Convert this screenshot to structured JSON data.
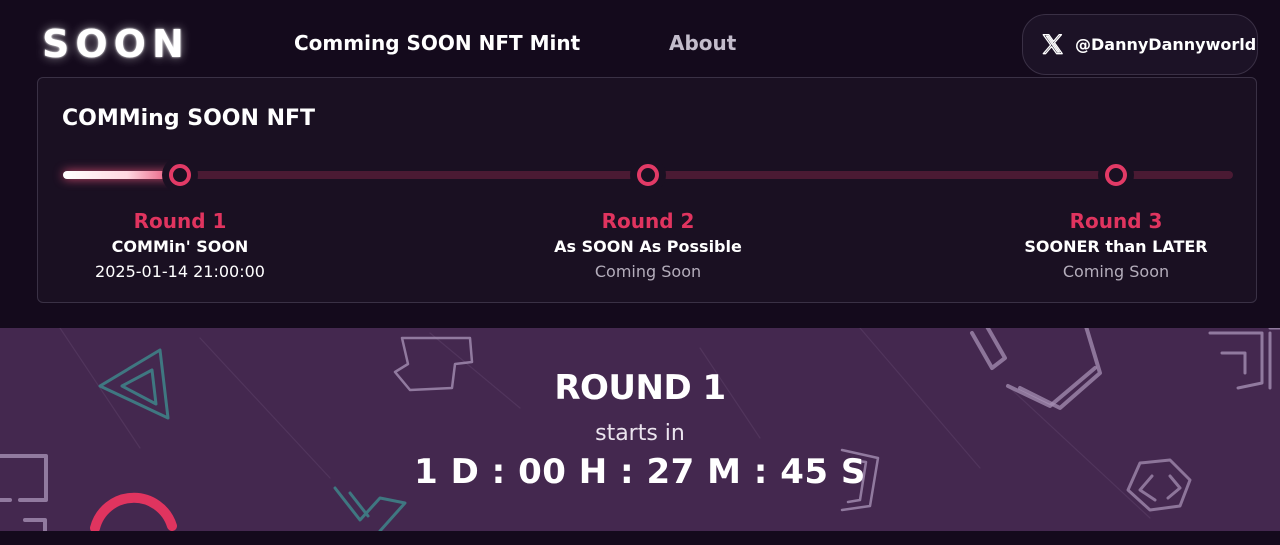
{
  "header": {
    "logo": "SOON",
    "nav": [
      {
        "label": "Comming SOON NFT Mint",
        "active": true
      },
      {
        "label": "About",
        "active": false
      }
    ],
    "social": {
      "icon": "x-logo-icon",
      "handle": "@DannyDannyworld"
    }
  },
  "card": {
    "title": "COMMing SOON NFT",
    "progress": 0.1,
    "rounds": [
      {
        "label": "Round 1",
        "name": "COMMin' SOON",
        "date": "2025-01-14 21:00:00"
      },
      {
        "label": "Round 2",
        "name": "As SOON As Possible",
        "date": "Coming Soon"
      },
      {
        "label": "Round 3",
        "name": "SOONER than LATER",
        "date": "Coming Soon"
      }
    ]
  },
  "countdown": {
    "title": "ROUND 1",
    "subtitle": "starts in",
    "timer": "1 D : 00 H : 27 M : 45 S"
  },
  "colors": {
    "background": "#140a1c",
    "accent": "#e0345f",
    "banner": "#44284f"
  }
}
